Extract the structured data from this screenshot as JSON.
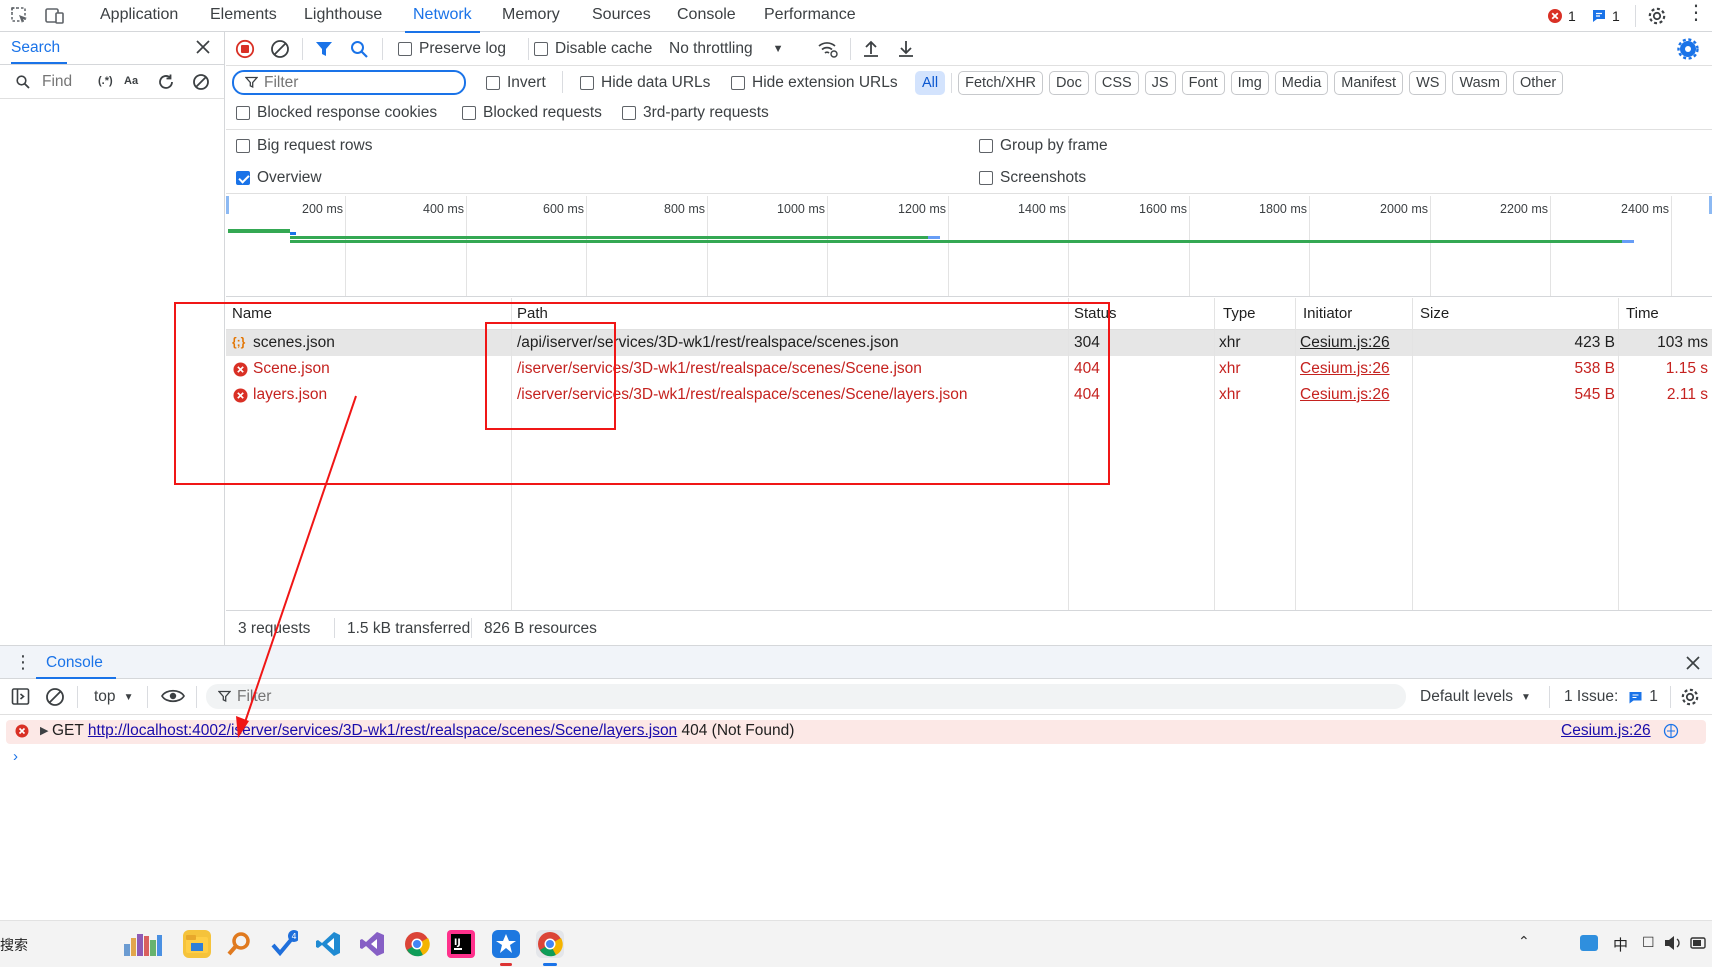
{
  "tabs": [
    "Application",
    "Elements",
    "Lighthouse",
    "Network",
    "Memory",
    "Sources",
    "Console",
    "Performance"
  ],
  "active_tab": "Network",
  "badges": {
    "errors": "1",
    "issues": "1"
  },
  "drawer": {
    "title": "Search",
    "find_placeholder": "Find",
    "regex": "(.*)",
    "case": "Aa"
  },
  "toolbar": {
    "preserve_log": "Preserve log",
    "disable_cache": "Disable cache",
    "throttling": "No throttling"
  },
  "filter": {
    "placeholder": "Filter",
    "invert": "Invert",
    "hide_data_urls": "Hide data URLs",
    "hide_extension_urls": "Hide extension URLs",
    "types": [
      "All",
      "Fetch/XHR",
      "Doc",
      "CSS",
      "JS",
      "Font",
      "Img",
      "Media",
      "Manifest",
      "WS",
      "Wasm",
      "Other"
    ],
    "blocked_cookies": "Blocked response cookies",
    "blocked_requests": "Blocked requests",
    "third_party": "3rd-party requests"
  },
  "options": {
    "big_rows": "Big request rows",
    "group_by_frame": "Group by frame",
    "overview": "Overview",
    "screenshots": "Screenshots"
  },
  "timeline": {
    "ticks": [
      "200 ms",
      "400 ms",
      "600 ms",
      "800 ms",
      "1000 ms",
      "1200 ms",
      "1400 ms",
      "1600 ms",
      "1800 ms",
      "2000 ms",
      "2200 ms",
      "2400 ms"
    ]
  },
  "table": {
    "columns": [
      "Name",
      "Path",
      "Status",
      "Type",
      "Initiator",
      "Size",
      "Time"
    ],
    "rows": [
      {
        "name": "scenes.json",
        "path": "/api/iserver/services/3D-wk1/rest/realspace/scenes.json",
        "status": "304",
        "type": "xhr",
        "initiator": "Cesium.js:26",
        "size": "423 B",
        "time": "103 ms",
        "error": false
      },
      {
        "name": "Scene.json",
        "path": "/iserver/services/3D-wk1/rest/realspace/scenes/Scene.json",
        "status": "404",
        "type": "xhr",
        "initiator": "Cesium.js:26",
        "size": "538 B",
        "time": "1.15 s",
        "error": true
      },
      {
        "name": "layers.json",
        "path": "/iserver/services/3D-wk1/rest/realspace/scenes/Scene/layers.json",
        "status": "404",
        "type": "xhr",
        "initiator": "Cesium.js:26",
        "size": "545 B",
        "time": "2.11 s",
        "error": true
      }
    ]
  },
  "statusbar": {
    "requests": "3 requests",
    "transferred": "1.5 kB transferred",
    "resources": "826 B resources"
  },
  "console": {
    "tab": "Console",
    "context": "top",
    "filter_placeholder": "Filter",
    "levels": "Default levels",
    "issues_label": "1 Issue:",
    "issues_count": "1",
    "message": {
      "method": "GET",
      "url": "http://localhost:4002/iserver/services/3D-wk1/rest/realspace/scenes/Scene/layers.json",
      "status": "404 (Not Found)",
      "source": "Cesium.js:26"
    }
  },
  "taskbar": {
    "search": "搜索",
    "ime": "中"
  },
  "colors": {
    "accent": "#1a73e8",
    "error": "#c5221f",
    "annotation": "#f01616",
    "timeline_bar": "#34a853"
  }
}
